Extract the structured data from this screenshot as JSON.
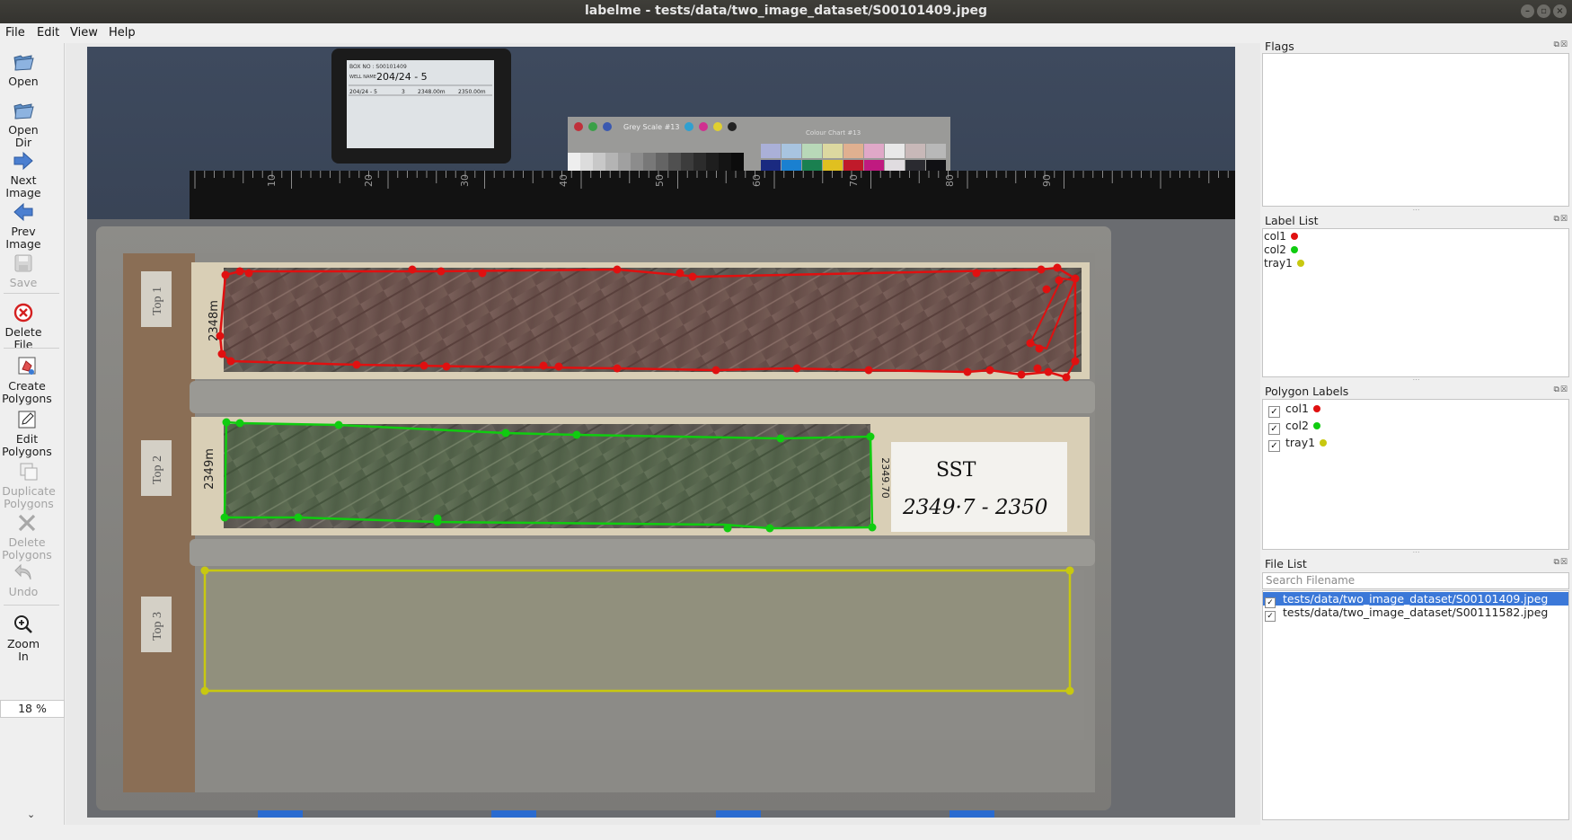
{
  "window": {
    "title": "labelme - tests/data/two_image_dataset/S00101409.jpeg"
  },
  "menubar": {
    "items": [
      "File",
      "Edit",
      "View",
      "Help"
    ]
  },
  "toolbar": {
    "open": "Open",
    "open_dir_1": "Open",
    "open_dir_2": "Dir",
    "next_1": "Next",
    "next_2": "Image",
    "prev_1": "Prev",
    "prev_2": "Image",
    "save": "Save",
    "delete_file_1": "Delete",
    "delete_file_2": "File",
    "create_1": "Create",
    "create_2": "Polygons",
    "edit_1": "Edit",
    "edit_2": "Polygons",
    "duplicate_1": "Duplicate",
    "duplicate_2": "Polygons",
    "delete_poly_1": "Delete",
    "delete_poly_2": "Polygons",
    "undo": "Undo",
    "zoom_1": "Zoom",
    "zoom_2": "In",
    "zoom_value": "18 %"
  },
  "panels": {
    "flags": {
      "title": "Flags"
    },
    "label_list": {
      "title": "Label List",
      "items": [
        {
          "label": "col1",
          "color": "#e01010"
        },
        {
          "label": "col2",
          "color": "#10cc10"
        },
        {
          "label": "tray1",
          "color": "#c8c810"
        }
      ]
    },
    "polygon_labels": {
      "title": "Polygon Labels",
      "items": [
        {
          "label": "col1",
          "checked": "✓",
          "color": "#e01010"
        },
        {
          "label": "col2",
          "checked": "✓",
          "color": "#10cc10"
        },
        {
          "label": "tray1",
          "checked": "✓",
          "color": "#c8c810"
        }
      ]
    },
    "file_list": {
      "title": "File List",
      "search_placeholder": "Search Filename",
      "files": [
        {
          "name": "tests/data/two_image_dataset/S00101409.jpeg",
          "checked": "✓",
          "selected": true
        },
        {
          "name": "tests/data/two_image_dataset/S00111582.jpeg",
          "checked": "✓",
          "selected": false
        }
      ]
    }
  },
  "photo": {
    "box_text": "BOX NO : S00101409",
    "well_name_label": "WELL NAME",
    "well_name": "204/24 - 5",
    "tablet_row": [
      "204/24 - 5",
      "3",
      "2348.00m",
      "2350.00m"
    ],
    "grey_scale": "Grey Scale #13",
    "colour_chart": "Colour Chart #13",
    "ruler_numbers": [
      "10",
      "20",
      "30",
      "40",
      "50",
      "60",
      "70",
      "80",
      "90"
    ],
    "tray_labels": [
      "Top 1",
      "Top 2",
      "Top 3"
    ],
    "depth_mark_1": "2348m",
    "depth_mark_2": "2349m",
    "depth_mark_3": "2349.70",
    "card_line_1": "SST",
    "card_line_2": "2349·7 - 2350"
  },
  "colors": {
    "col1": "#e01010",
    "col2": "#10cc10",
    "tray1": "#c8c810",
    "selection": "#3b78d8"
  }
}
